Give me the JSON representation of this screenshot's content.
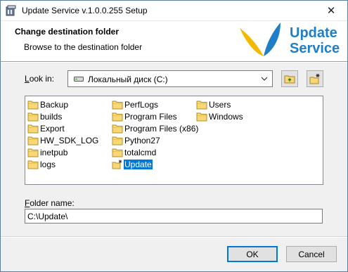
{
  "window": {
    "title": "Update Service v.1.0.0.255 Setup",
    "close_glyph": "✕"
  },
  "header": {
    "title": "Change destination folder",
    "subtitle": "Browse to the destination folder",
    "logo_line1": "Update",
    "logo_line2": "Service",
    "logo_color": "#1e7fc8",
    "logo_accent": "#f5b800"
  },
  "lookin": {
    "label_prefix": "L",
    "label_rest": "ook in:",
    "value": "Локальный диск (C:)",
    "up_icon": "folder-up-icon",
    "new_icon": "new-folder-icon"
  },
  "folders": {
    "col1": [
      "Backup",
      "builds",
      "Export",
      "HW_SDK_LOG",
      "inetpub",
      "logs"
    ],
    "col2": [
      "PerfLogs",
      "Program Files",
      "Program Files (x86)",
      "Python27",
      "totalcmd",
      "Update"
    ],
    "col3": [
      "Users",
      "Windows"
    ],
    "selected": "Update"
  },
  "folder_name": {
    "label_prefix": "F",
    "label_rest": "older name:",
    "value": "C:\\Update\\"
  },
  "buttons": {
    "ok": "OK",
    "cancel": "Cancel"
  },
  "colors": {
    "selection": "#0078d7",
    "folder_fill": "#f8d775"
  }
}
